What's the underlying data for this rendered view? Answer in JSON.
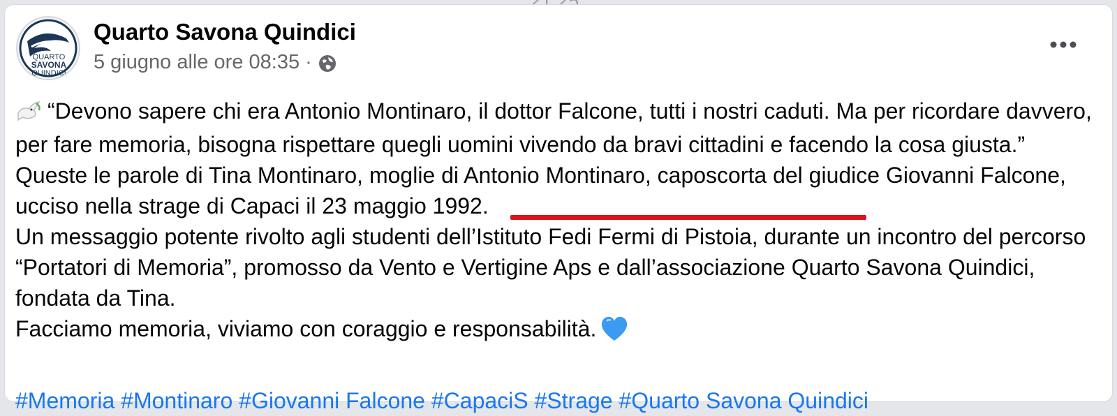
{
  "top_fragment": "21 25",
  "post": {
    "page_name": "Quarto Savona Quindici",
    "avatar_text": [
      "QUARTO",
      "SAVONA",
      "QUINDICI"
    ],
    "timestamp": "5 giugno alle ore 08:35",
    "separator": "·",
    "privacy_icon": "globe-icon",
    "more_icon": "more-horizontal-icon",
    "paragraphs": [
      "“Devono sapere chi era Antonio Montinaro, il dottor Falcone, tutti i nostri caduti. Ma per ricordare davvero, per fare memoria, bisogna rispettare quegli uomini vivendo da bravi cittadini e facendo la cosa giusta.”",
      "Queste le parole di Tina Montinaro, moglie di Antonio Montinaro, caposcorta del giudice Giovanni Falcone, ucciso nella strage di Capaci il 23 maggio 1992.",
      "Un messaggio potente rivolto agli studenti dell’Istituto Fedi Fermi di Pistoia, durante un incontro del percorso “Portatori di Memoria”, promosso da Vento e Vertigine Aps e dall’associazione Quarto Savona Quindici, fondata da Tina.",
      "Facciamo memoria, viviamo con coraggio e responsabilità."
    ],
    "emojis": {
      "lead": "dove-icon",
      "trail": "blue-heart-icon"
    },
    "hashtags_partial": "#Memoria #Montinaro #Giovanni Falcone #CapaciS #Strage #Quarto Savona Quindici"
  },
  "colors": {
    "text": "#050505",
    "meta": "#65676b",
    "link": "#1877f2",
    "annotation": "#d9141c"
  }
}
